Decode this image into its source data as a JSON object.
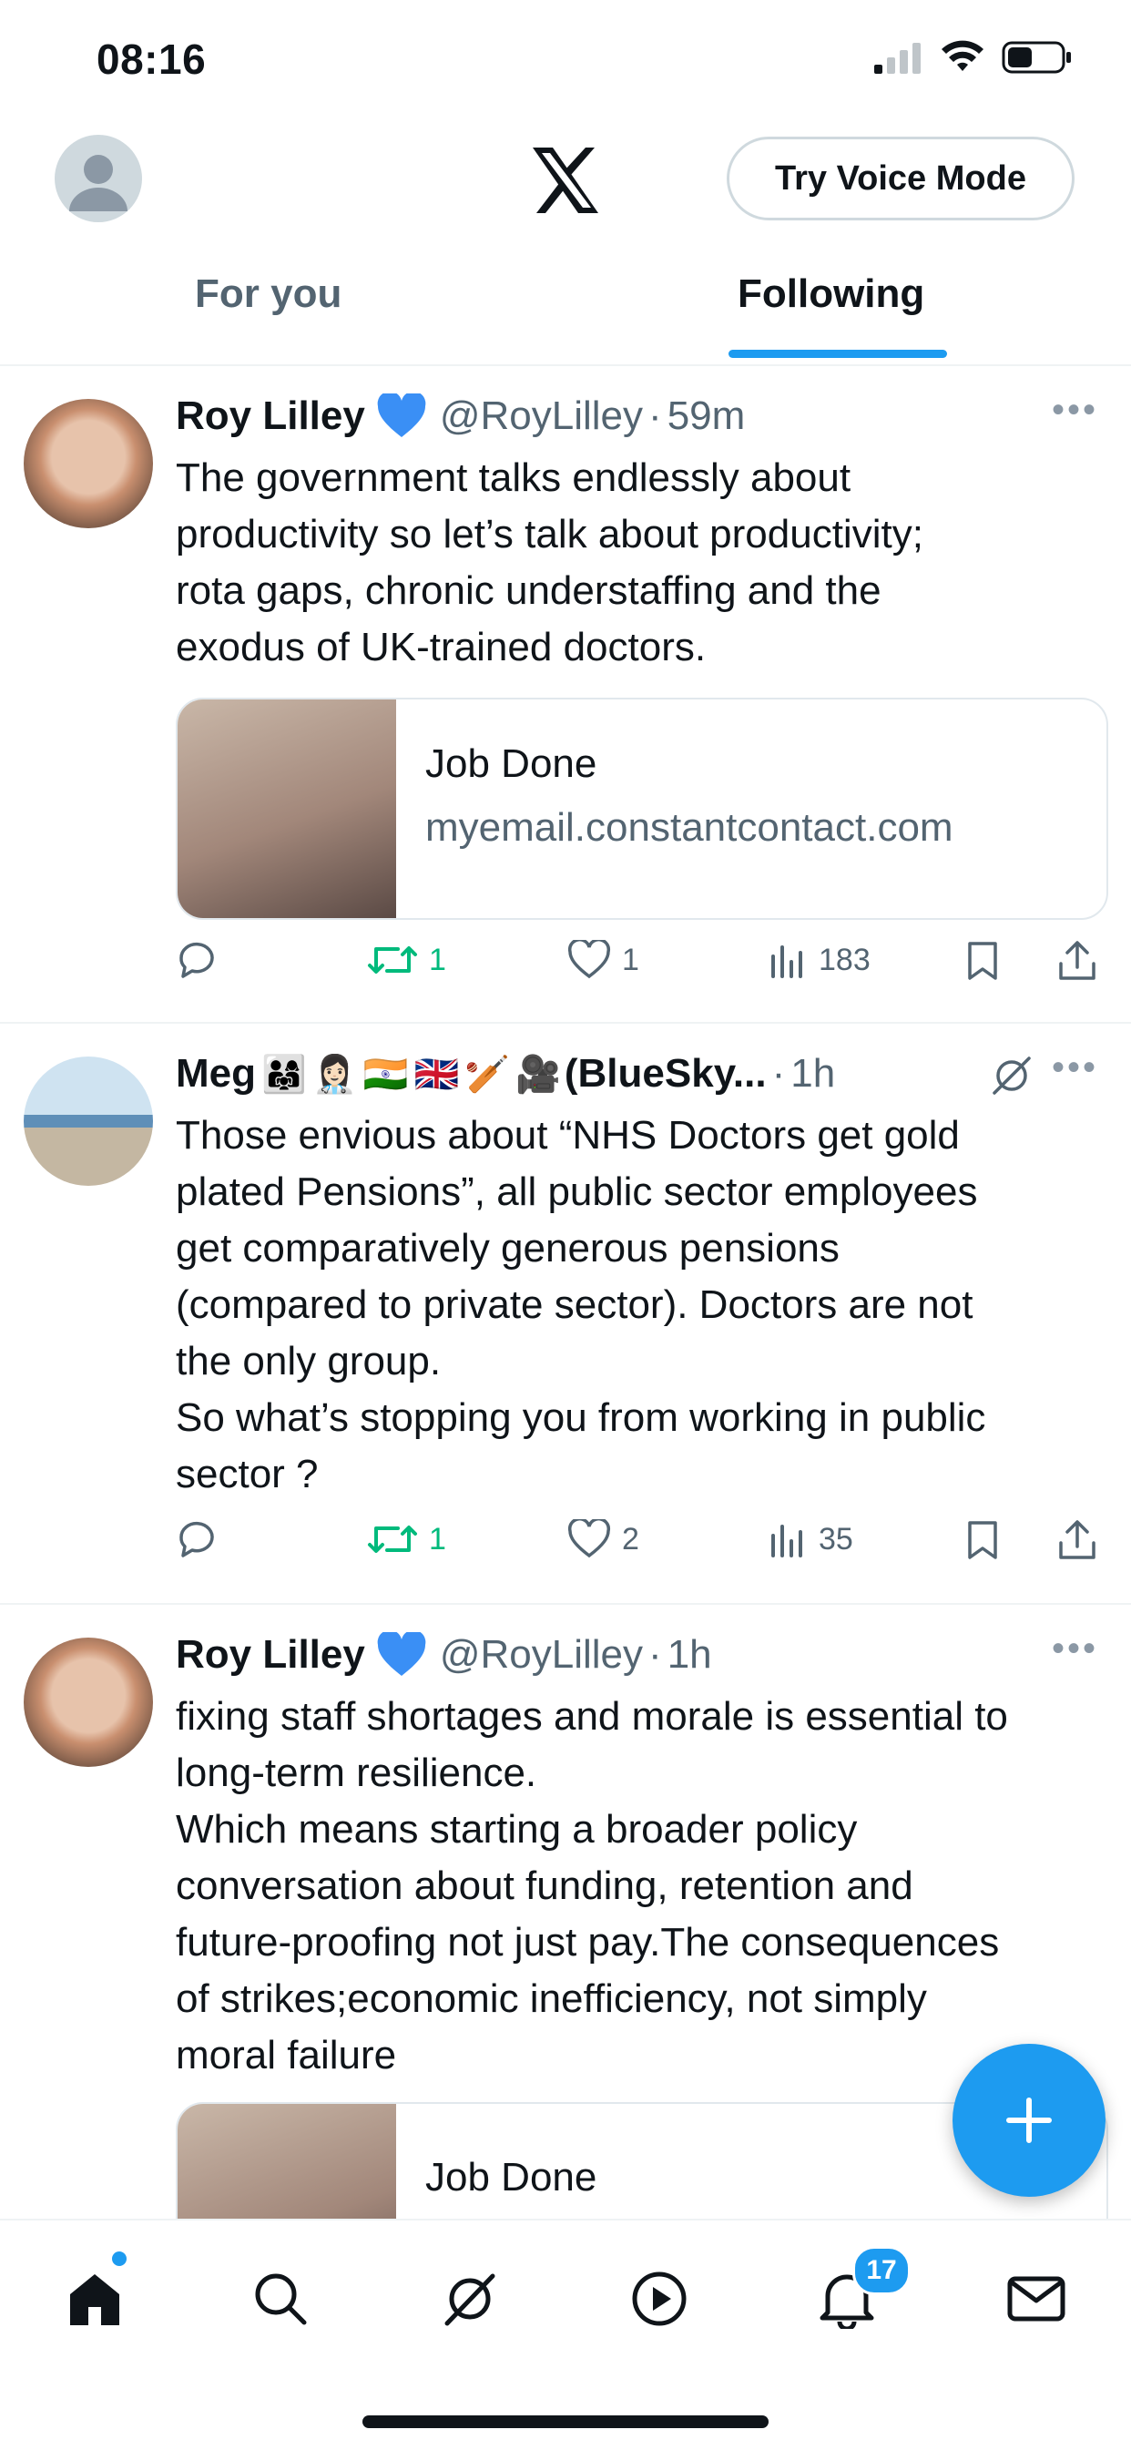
{
  "status_bar": {
    "time": "08:16"
  },
  "header": {
    "voice_button": "Try Voice Mode"
  },
  "tabs": [
    {
      "label": "For you"
    },
    {
      "label": "Following"
    }
  ],
  "posts": [
    {
      "name": "Roy Lilley",
      "handle": "@RoyLilley",
      "time": "59m",
      "text": "The government talks endlessly about\nproductivity so let’s talk about productivity;\nrota gaps, chronic understaffing and the\nexodus of UK-trained doctors.",
      "card": {
        "title": "Job Done",
        "domain": "myemail.constantcontact.com"
      },
      "replies": "",
      "reposts": "1",
      "likes": "1",
      "views": "183"
    },
    {
      "name": "Meg",
      "name_suffix": "(BlueSky...",
      "time": "1h",
      "text": "Those envious about “NHS Doctors get gold\nplated Pensions”, all public sector employees\nget comparatively generous pensions\n(compared to private sector). Doctors are not\nthe only group.\nSo what’s stopping you from working in public\nsector ?",
      "replies": "",
      "reposts": "1",
      "likes": "2",
      "views": "35"
    },
    {
      "name": "Roy Lilley",
      "handle": "@RoyLilley",
      "time": "1h",
      "text": "fixing staff shortages and morale is essential to\nlong-term resilience.\nWhich means starting a broader policy\nconversation about funding, retention and\nfuture-proofing not just pay.The consequences\nof strikes;economic inefficiency, not simply\nmoral failure",
      "card": {
        "title": "Job Done"
      }
    }
  ],
  "bottom_nav": {
    "notifications_badge": "17"
  },
  "colors": {
    "accent": "#1d9bf0",
    "repost": "#00ba7c",
    "muted": "#536471"
  },
  "icons": [
    "x-logo-icon",
    "signal-icon",
    "wifi-icon",
    "battery-icon",
    "reply-icon",
    "repost-icon",
    "like-icon",
    "views-icon",
    "bookmark-icon",
    "share-icon",
    "home-icon",
    "search-icon",
    "grok-icon",
    "play-icon",
    "bell-icon",
    "mail-icon",
    "plus-icon"
  ]
}
